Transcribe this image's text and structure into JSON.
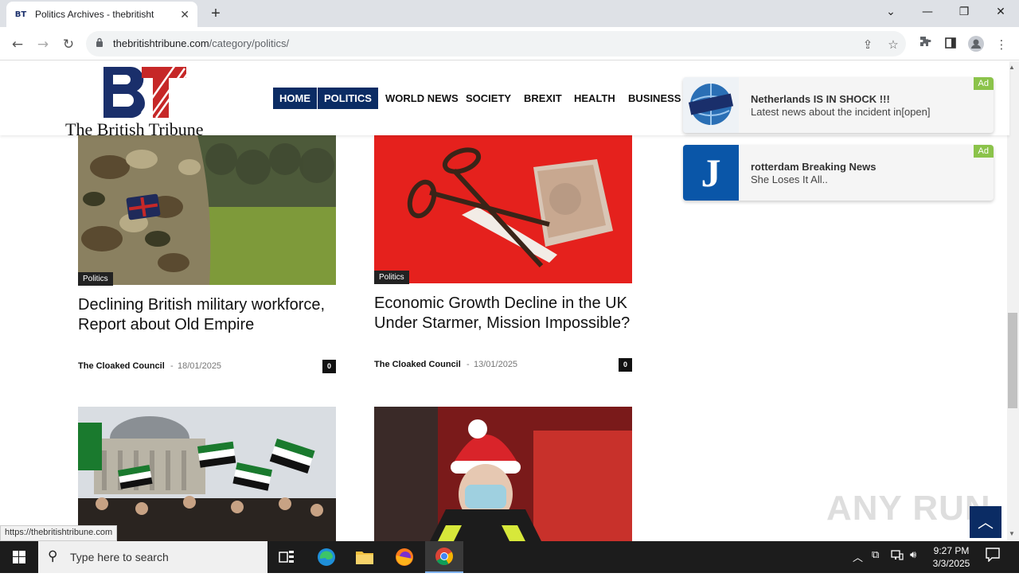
{
  "browser": {
    "tab_title": "Politics Archives - thebritishtribune",
    "tab_favicon": "BT",
    "url_host": "thebritishtribune.com",
    "url_path": "/category/politics/",
    "status_url": "https://thebritishtribune.com"
  },
  "site": {
    "logo_text": "The British Tribune",
    "brand_color": "#0b2c64",
    "menu": [
      {
        "label": "HOME",
        "active": true
      },
      {
        "label": "POLITICS",
        "active": true
      },
      {
        "label": "WORLD NEWS",
        "active": false
      },
      {
        "label": "SOCIETY",
        "active": false
      },
      {
        "label": "BREXIT",
        "active": false
      },
      {
        "label": "HEALTH",
        "active": false
      },
      {
        "label": "BUSINESS",
        "active": false
      }
    ]
  },
  "articles": [
    {
      "category": "Politics",
      "headline": "Declining British military workforce, Report about Old Empire",
      "author": "The Cloaked Council",
      "date": "18/01/2025",
      "comments": "0"
    },
    {
      "category": "Politics",
      "headline": "Economic Growth Decline in the UK Under Starmer, Mission Impossible?",
      "author": "The Cloaked Council",
      "date": "13/01/2025",
      "comments": "0"
    }
  ],
  "ads": [
    {
      "title": "Netherlands IS IN SHOCK !!!",
      "subtitle": "Latest news about the incident in[open]",
      "tag": "Ad",
      "icon": "news-globe-icon"
    },
    {
      "title": "rotterdam Breaking News",
      "subtitle": "She Loses It All..",
      "tag": "Ad",
      "icon": "j-letter-icon",
      "letter": "J"
    }
  ],
  "watermark": "ANY RUN",
  "taskbar": {
    "search_placeholder": "Type here to search",
    "time": "9:27 PM",
    "date": "3/3/2025"
  }
}
